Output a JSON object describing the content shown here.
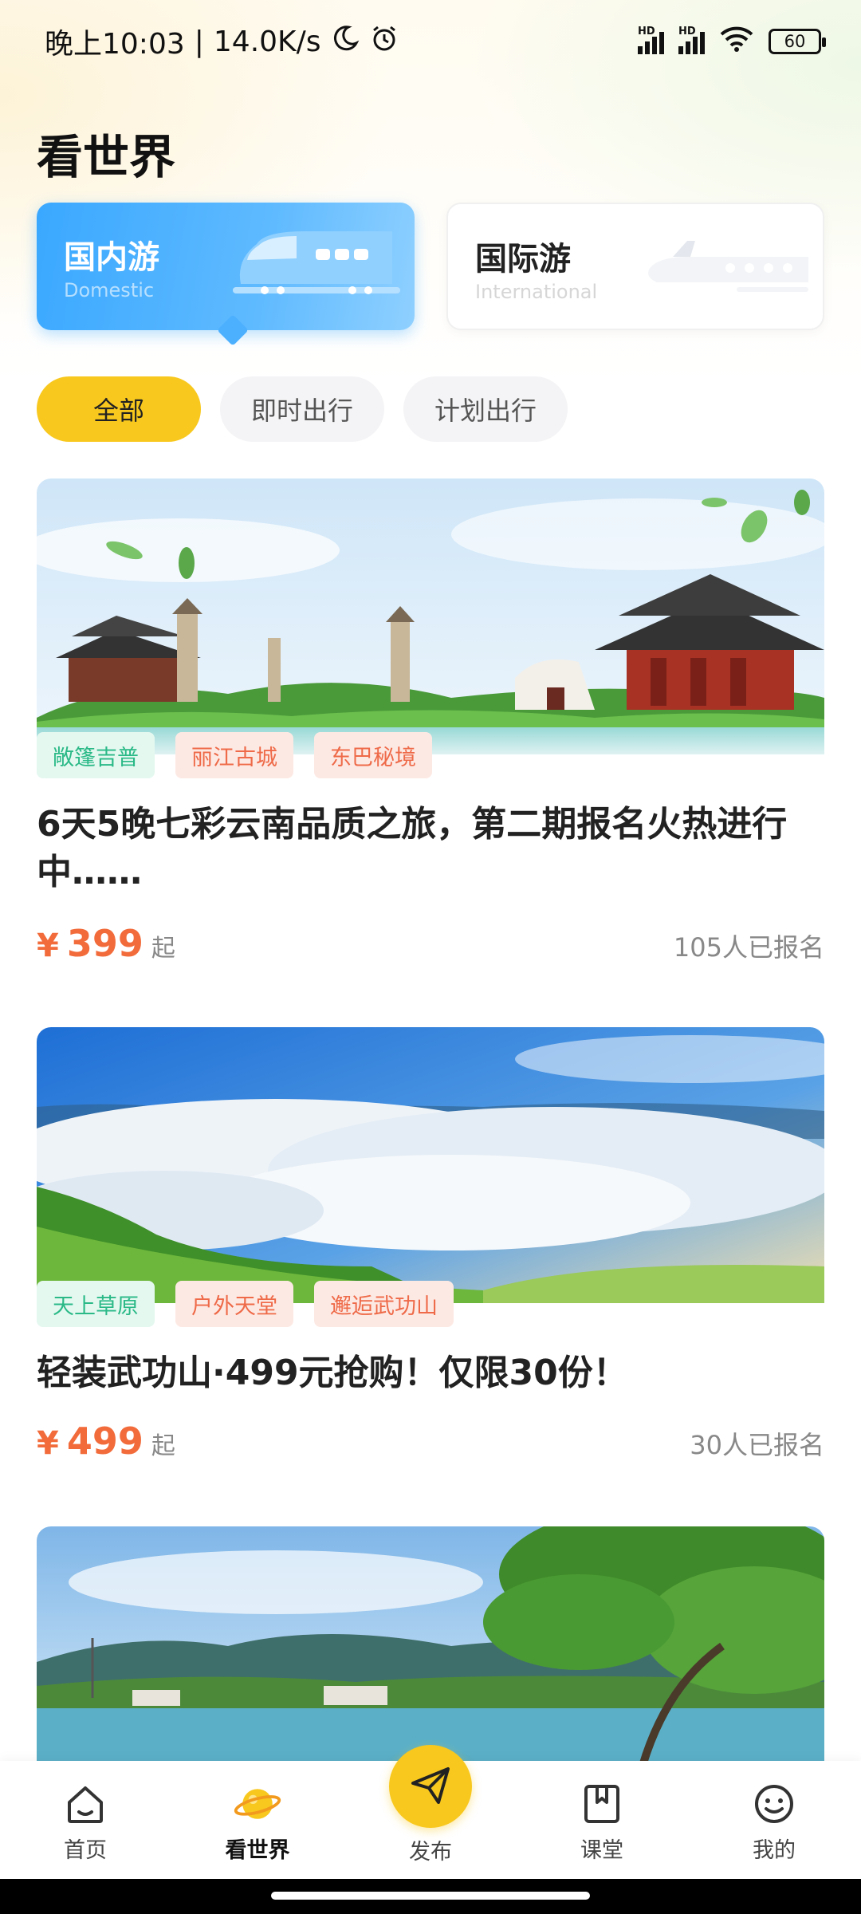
{
  "status_bar": {
    "time": "晚上10:03",
    "separator": "|",
    "speed": "14.0K/s",
    "battery": "60",
    "icons": [
      "moon-icon",
      "alarm-icon",
      "hd-signal-icon",
      "hd-signal-icon",
      "wifi-icon",
      "battery-icon"
    ]
  },
  "page_title": "看世界",
  "categories": [
    {
      "title": "国内游",
      "subtitle": "Domestic",
      "selected": true
    },
    {
      "title": "国际游",
      "subtitle": "International",
      "selected": false
    }
  ],
  "filters": [
    {
      "label": "全部",
      "active": true
    },
    {
      "label": "即时出行",
      "active": false
    },
    {
      "label": "计划出行",
      "active": false
    }
  ],
  "trips": [
    {
      "tags": [
        {
          "label": "敞篷吉普",
          "color": "green"
        },
        {
          "label": "丽江古城",
          "color": "orange"
        },
        {
          "label": "东巴秘境",
          "color": "orange"
        }
      ],
      "title": "6天5晚七彩云南品质之旅，第二期报名火热进行中……",
      "currency": "¥",
      "price": "399",
      "price_suffix": "起",
      "signed_up": "105人已报名"
    },
    {
      "tags": [
        {
          "label": "天上草原",
          "color": "green"
        },
        {
          "label": "户外天堂",
          "color": "orange"
        },
        {
          "label": "邂逅武功山",
          "color": "orange"
        }
      ],
      "title": "轻装武功山·499元抢购！仅限30份！",
      "currency": "¥",
      "price": "499",
      "price_suffix": "起",
      "signed_up": "30人已报名"
    }
  ],
  "bottom_nav": [
    {
      "label": "首页",
      "icon": "home-icon"
    },
    {
      "label": "看世界",
      "icon": "planet-icon",
      "active": true
    },
    {
      "label": "发布",
      "icon": "paper-plane-icon"
    },
    {
      "label": "课堂",
      "icon": "bookmark-book-icon"
    },
    {
      "label": "我的",
      "icon": "smiley-icon"
    }
  ],
  "colors": {
    "accent_yellow": "#f8c81e",
    "domestic_blue": "#3aa8ff",
    "price_orange": "#f26b3a",
    "tag_green": "#2ab987",
    "tag_orange": "#ee6a48"
  }
}
